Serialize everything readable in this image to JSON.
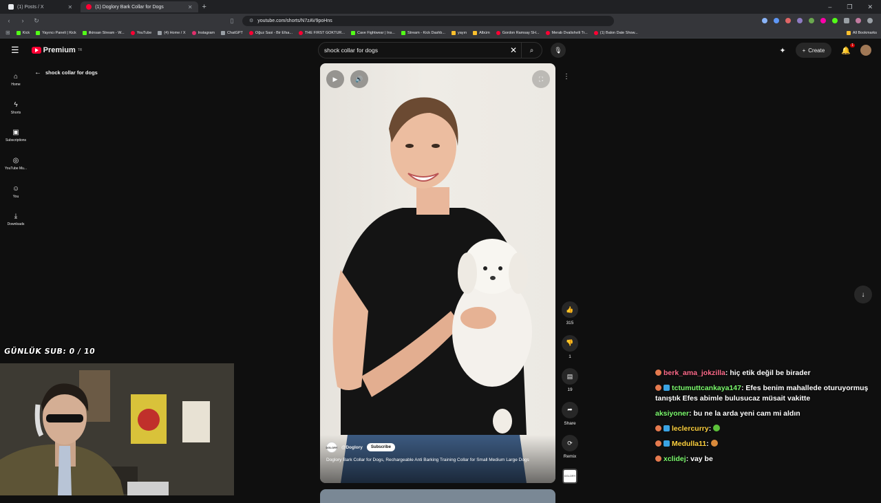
{
  "browser": {
    "tabs": [
      {
        "label": "(1) Posts / X",
        "active": false
      },
      {
        "label": "(1) Doglory Bark Collar for Dogs",
        "active": true
      }
    ],
    "new_tab_icon": "plus-icon",
    "url": "youtube.com/shorts/N7zAV9poHns",
    "bookmarks": [
      {
        "label": "Kick",
        "kind": "kick"
      },
      {
        "label": "Yayıncı Paneli | Kick",
        "kind": "kick"
      },
      {
        "label": "ilkinsan Stream - W...",
        "kind": "kick"
      },
      {
        "label": "YouTube",
        "kind": "yt"
      },
      {
        "label": "(4) Home / X",
        "kind": "x"
      },
      {
        "label": "Instagram",
        "kind": "yt"
      },
      {
        "label": "ChatGPT",
        "kind": "gray"
      },
      {
        "label": "Oğuz Sasi - Bir Efsa...",
        "kind": "yt"
      },
      {
        "label": "THE FIRST GOKTUR...",
        "kind": "yt"
      },
      {
        "label": "Cave Fightwear | Ins...",
        "kind": "kick"
      },
      {
        "label": "Stream - Kick Dashb...",
        "kind": "kick"
      },
      {
        "label": "yayın",
        "kind": "folder"
      },
      {
        "label": "Albüm",
        "kind": "folder"
      },
      {
        "label": "Gordon Ramsay SH...",
        "kind": "yt"
      },
      {
        "label": "Merab Dvalishvili Tr...",
        "kind": "yt"
      },
      {
        "label": "(1) Balon Date Show...",
        "kind": "yt"
      }
    ],
    "all_bookmarks": "All Bookmarks"
  },
  "youtube": {
    "logo_text": "Premium",
    "logo_sup": "TR",
    "search_value": "shock collar for dogs",
    "create_label": "Create",
    "notification_count": "1",
    "back_label": "shock collar for dogs",
    "rail": [
      {
        "label": "Home",
        "icon": "home-icon",
        "glyph": "⌂"
      },
      {
        "label": "Shorts",
        "icon": "shorts-icon",
        "glyph": "ϟ"
      },
      {
        "label": "Subscriptions",
        "icon": "subscriptions-icon",
        "glyph": "▣"
      },
      {
        "label": "YouTube Mu...",
        "icon": "music-icon",
        "glyph": "◎"
      },
      {
        "label": "You",
        "icon": "user-icon",
        "glyph": "☺"
      },
      {
        "label": "Downloads",
        "icon": "download-icon",
        "glyph": "⤓"
      }
    ]
  },
  "short": {
    "channel_avatar_text": "DGLORY",
    "channel": "@Doglory",
    "subscribe_label": "Subscribe",
    "title": "Doglory Bark Collar for Dogs, Rechargeable Anti Barking Training Collar for Small Medium Large Dogs",
    "likes": "315",
    "dislikes": "1",
    "comments": "19",
    "share_label": "Share",
    "remix_label": "Remix",
    "audio_thumb_text": "DGLORY"
  },
  "stream": {
    "sub_goal": "GÜNLÜK SUB: 0 / 10",
    "chat": [
      {
        "user": "berk_ama_jokzilla",
        "user_color": "#ff6b8b",
        "badge": "sub",
        "text": "hiç etik değil be birader"
      },
      {
        "user": "tctumuttcankaya147",
        "user_color": "#7cfc6e",
        "badge": "sub2",
        "text": "Efes benim mahallede oturuyormuş tanıştık Efes abimle bulusucaz müsait vakitte"
      },
      {
        "user": "aksiyoner",
        "user_color": "#7cfc6e",
        "badge": "",
        "text": "bu ne la arda yeni cam mi aldın"
      },
      {
        "user": "leclercurry",
        "user_color": "#ffd23f",
        "badge": "sub2",
        "text": "",
        "emote": "#5cc13a"
      },
      {
        "user": "Medulla11",
        "user_color": "#ffd23f",
        "badge": "sub2",
        "text": "",
        "emote": "#d98a3a"
      },
      {
        "user": "xclidej",
        "user_color": "#7cfc6e",
        "badge": "sub",
        "text": "vay be"
      }
    ]
  },
  "colors": {
    "youtube_red": "#ff0033",
    "kick_green": "#53fc18",
    "page_bg": "#0f0f0f"
  }
}
